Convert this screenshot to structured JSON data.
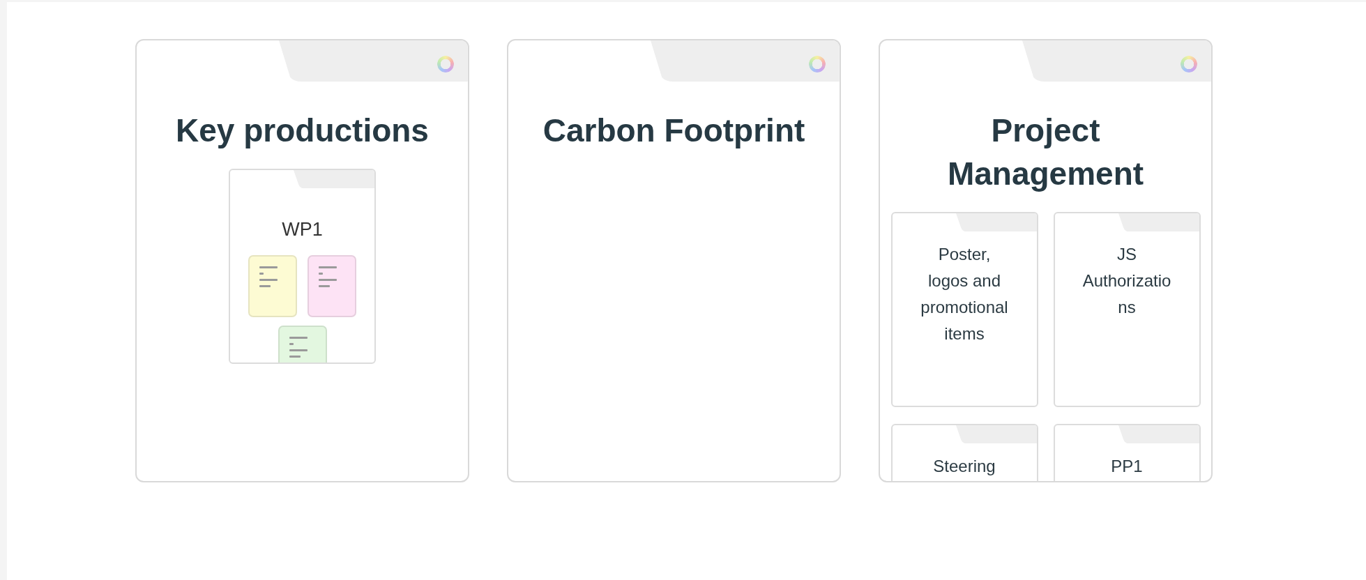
{
  "boards": [
    {
      "title": "Key productions",
      "children": [
        {
          "title": "WP1",
          "notes": [
            {
              "color": "#fdfbd3"
            },
            {
              "color": "#fde3f5"
            },
            {
              "color": "#e3f7e0"
            }
          ]
        }
      ]
    },
    {
      "title": "Carbon Footprint"
    },
    {
      "title": "Project Management",
      "children": [
        {
          "title": "Poster, logos and promotional items"
        },
        {
          "title": "JS Authorizations"
        },
        {
          "title": "Steering"
        },
        {
          "title": "PP1"
        }
      ]
    }
  ]
}
